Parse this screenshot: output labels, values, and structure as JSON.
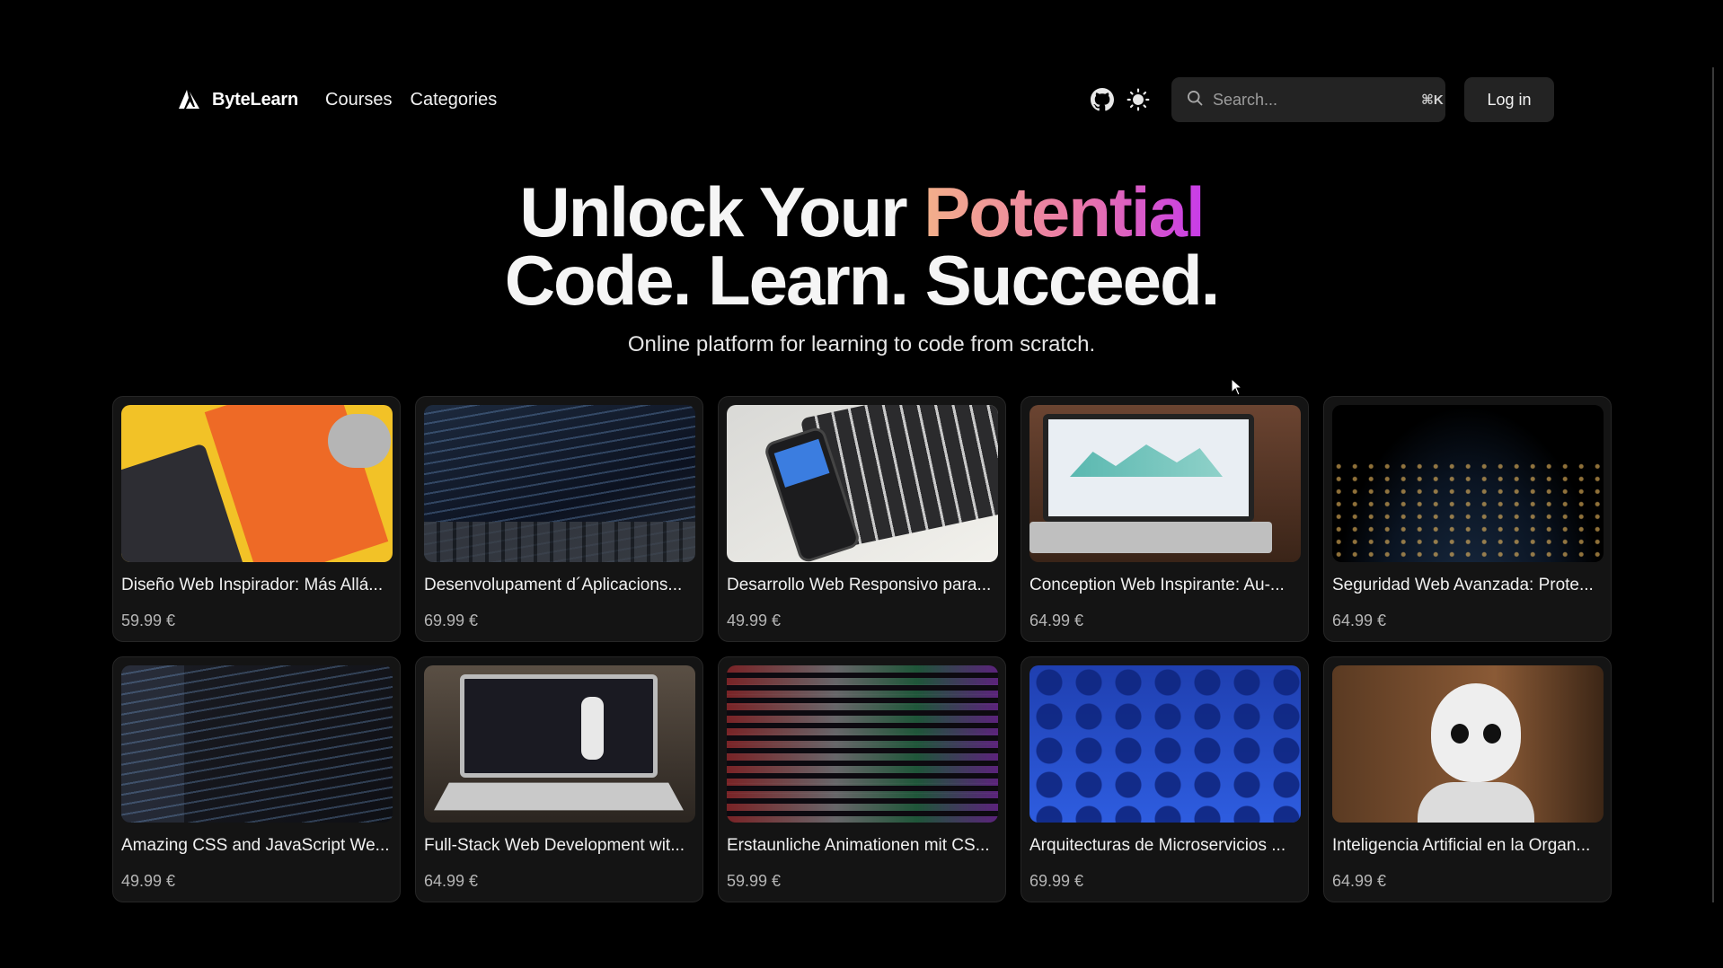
{
  "header": {
    "brand": "ByteLearn",
    "nav": [
      "Courses",
      "Categories"
    ],
    "search_placeholder": "Search...",
    "search_shortcut": "⌘K",
    "login_label": "Log in",
    "icons": [
      "github-icon",
      "sun-icon",
      "search-icon",
      "logo-icon"
    ]
  },
  "hero": {
    "line1_prefix": "Unlock Your ",
    "line1_highlight": "Potential",
    "line2": "Code. Learn. Succeed.",
    "subtitle": "Online platform for learning to code from scratch.",
    "highlight_gradient": [
      "#f3b08a",
      "#ea78a8",
      "#c73be8"
    ]
  },
  "courses": [
    {
      "title": "Diseño Web Inspirador: Más Allá...",
      "price": "59.99 €"
    },
    {
      "title": "Desenvolupament d´Aplicacions...",
      "price": "69.99 €"
    },
    {
      "title": "Desarrollo Web Responsivo para...",
      "price": "49.99 €"
    },
    {
      "title": "Conception Web Inspirante: Au-...",
      "price": "64.99 €"
    },
    {
      "title": "Seguridad Web Avanzada: Prote...",
      "price": "64.99 €"
    },
    {
      "title": "Amazing CSS and JavaScript We...",
      "price": "49.99 €"
    },
    {
      "title": "Full-Stack Web Development wit...",
      "price": "64.99 €"
    },
    {
      "title": "Erstaunliche Animationen mit CS...",
      "price": "59.99 €"
    },
    {
      "title": "Arquitecturas de Microservicios ...",
      "price": "69.99 €"
    },
    {
      "title": "Inteligencia Artificial en la Organ...",
      "price": "64.99 €"
    }
  ],
  "colors": {
    "background": "#000000",
    "card": "#141414",
    "control": "#232323"
  }
}
